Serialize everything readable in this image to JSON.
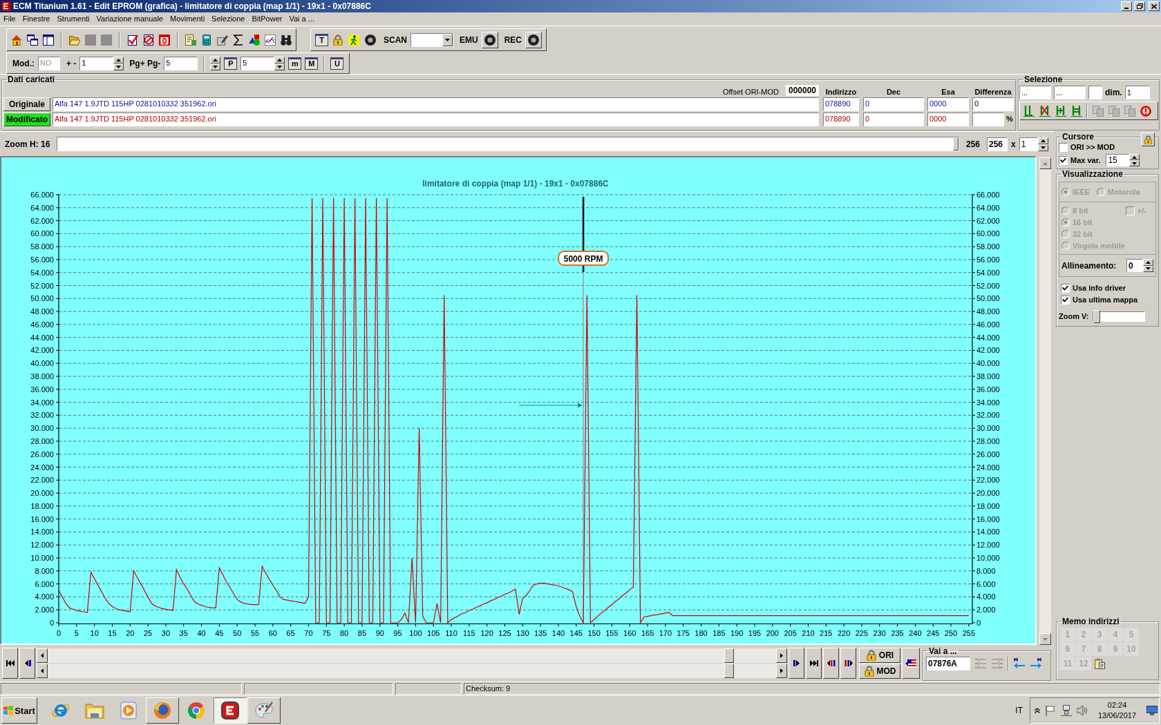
{
  "window": {
    "title": "ECM Titanium 1.61 - Edit EPROM (grafica) - limitatore di coppia (map 1/1) - 19x1 - 0x07886C"
  },
  "menu": [
    "File",
    "Finestre",
    "Strumenti",
    "Variazione manuale",
    "Movimenti",
    "Selezione",
    "BitPower",
    "Vai a ..."
  ],
  "toolbar": {
    "t_button": "T",
    "scan_label": "SCAN",
    "emu_label": "EMU",
    "rec_label": "REC"
  },
  "edit_bar": {
    "mod_label": "Mod.:",
    "mod_field": {
      "value": "NO",
      "disabled": true
    },
    "step_label": "+ -",
    "step_value": "1",
    "page_label": "Pg+ Pg-",
    "page_value": "5",
    "p_button": "P",
    "p_value": "5",
    "m_button": "m",
    "big_m_button": "M",
    "u_button": "U"
  },
  "loaded_data": {
    "title": "Dati caricati",
    "offset_label": "Offset ORI-MOD",
    "offset_value": "000000",
    "columns": [
      "Indirizzo",
      "Dec",
      "Esa",
      "Differenza"
    ],
    "rows": [
      {
        "label": "Originale",
        "selected": false,
        "color": "#10109a",
        "file": "Alfa 147 1.9JTD 115HP 0281010332 351962.ori",
        "address": "078890",
        "dec": "0",
        "hex": "0000",
        "difference": "0"
      },
      {
        "label": "Modificato",
        "selected": true,
        "color": "#b00000",
        "file": "Alfa 147 1.9JTD 115HP 0281010332 351962.ori",
        "address": "078890",
        "dec": "0",
        "hex": "0000",
        "unit": "%"
      }
    ]
  },
  "selection": {
    "title": "Selezione",
    "start": "...",
    "end": "...",
    "dim_label": "dim.",
    "dim_value": "1",
    "tools": [
      {
        "disabled": false
      },
      {
        "disabled": false
      },
      {
        "disabled": false
      },
      {
        "disabled": false
      },
      {
        "disabled": true
      },
      {
        "disabled": true
      },
      {
        "disabled": true
      },
      {
        "disabled": false
      }
    ]
  },
  "zoom_h": {
    "label": "Zoom H: 16",
    "level": 1,
    "max_label": "256",
    "value": "256",
    "times_label": "x",
    "factor": "1"
  },
  "chart": {
    "chart_data": {
      "type": "line",
      "title": "limitatore di coppia (map 1/1) - 19x1 - 0x07886C",
      "x": [
        0,
        1,
        2,
        3,
        4,
        5,
        6,
        7,
        8,
        9,
        10,
        11,
        12,
        13,
        14,
        15,
        16,
        17,
        18,
        19,
        20,
        21,
        22,
        23,
        24,
        25,
        26,
        27,
        28,
        29,
        30,
        31,
        32,
        33,
        34,
        35,
        36,
        37,
        38,
        39,
        40,
        41,
        42,
        43,
        44,
        45,
        46,
        47,
        48,
        49,
        50,
        51,
        52,
        53,
        54,
        55,
        56,
        57,
        58,
        59,
        60,
        61,
        62,
        63,
        64,
        65,
        66,
        67,
        68,
        69,
        70,
        71,
        72,
        73,
        74,
        75,
        76,
        77,
        78,
        79,
        80,
        81,
        82,
        83,
        84,
        85,
        86,
        87,
        88,
        89,
        90,
        91,
        92,
        93,
        94,
        95,
        96,
        97,
        98,
        99,
        100,
        101,
        102,
        103,
        104,
        105,
        106,
        107,
        108,
        109,
        110,
        111,
        112,
        113,
        114,
        115,
        116,
        117,
        118,
        119,
        120,
        121,
        122,
        123,
        124,
        125,
        126,
        127,
        128,
        129,
        130,
        131,
        132,
        133,
        134,
        135,
        136,
        137,
        138,
        139,
        140,
        141,
        142,
        143,
        144,
        145,
        146,
        147,
        148,
        149,
        150,
        151,
        152,
        153,
        154,
        155,
        156,
        157,
        158,
        159,
        160,
        161,
        162,
        163,
        164,
        165,
        166,
        167,
        168,
        169,
        170,
        171,
        172,
        173,
        174,
        175,
        176,
        177,
        178,
        179,
        180,
        181,
        182,
        183,
        184,
        185,
        186,
        187,
        188,
        189,
        190,
        191,
        192,
        193,
        194,
        195,
        196,
        197,
        198,
        199,
        200,
        201,
        202,
        203,
        204,
        205,
        206,
        207,
        208,
        209,
        210,
        211,
        212,
        213,
        214,
        215,
        216,
        217,
        218,
        219,
        220,
        221,
        222,
        223,
        224,
        225,
        226,
        227,
        228,
        229,
        230,
        231,
        232,
        233,
        234,
        235,
        236,
        237,
        238,
        239,
        240,
        241,
        242,
        243,
        244,
        245,
        246,
        247,
        248,
        249,
        250,
        251,
        252,
        253,
        254,
        255
      ],
      "xlim": [
        0,
        256
      ],
      "ylim": [
        0,
        66
      ],
      "xticks": [
        0,
        5,
        10,
        15,
        20,
        25,
        30,
        35,
        40,
        45,
        50,
        55,
        60,
        65,
        70,
        75,
        80,
        85,
        90,
        95,
        100,
        105,
        110,
        115,
        120,
        125,
        130,
        135,
        140,
        145,
        150,
        155,
        160,
        165,
        170,
        175,
        180,
        185,
        190,
        195,
        200,
        205,
        210,
        215,
        220,
        225,
        230,
        235,
        240,
        245,
        250,
        255
      ],
      "yticks": [
        {
          "value": 0,
          "label": "0"
        },
        {
          "value": 2,
          "label": "2.000"
        },
        {
          "value": 4,
          "label": "4.000"
        },
        {
          "value": 6,
          "label": "6.000"
        },
        {
          "value": 8,
          "label": "8.000"
        },
        {
          "value": 10,
          "label": "10.000"
        },
        {
          "value": 12,
          "label": "12.000"
        },
        {
          "value": 14,
          "label": "14.000"
        },
        {
          "value": 16,
          "label": "16.000"
        },
        {
          "value": 18,
          "label": "18.000"
        },
        {
          "value": 20,
          "label": "20.000"
        },
        {
          "value": 22,
          "label": "22.000"
        },
        {
          "value": 24,
          "label": "24.000"
        },
        {
          "value": 26,
          "label": "26.000"
        },
        {
          "value": 28,
          "label": "28.000"
        },
        {
          "value": 30,
          "label": "30.000"
        },
        {
          "value": 32,
          "label": "32.000"
        },
        {
          "value": 34,
          "label": "34.000"
        },
        {
          "value": 36,
          "label": "36.000"
        },
        {
          "value": 38,
          "label": "38.000"
        },
        {
          "value": 40,
          "label": "40.000"
        },
        {
          "value": 42,
          "label": "42.000"
        },
        {
          "value": 44,
          "label": "44.000"
        },
        {
          "value": 46,
          "label": "46.000"
        },
        {
          "value": 48,
          "label": "48.000"
        },
        {
          "value": 50,
          "label": "50.000"
        },
        {
          "value": 52,
          "label": "52.000"
        },
        {
          "value": 54,
          "label": "54.000"
        },
        {
          "value": 56,
          "label": "56.000"
        },
        {
          "value": 58,
          "label": "58.000"
        },
        {
          "value": 60,
          "label": "60.000"
        },
        {
          "value": 62,
          "label": "62.000"
        },
        {
          "value": 64,
          "label": "64.000"
        },
        {
          "value": 66,
          "label": "66.000"
        }
      ],
      "grid": true,
      "series": [
        {
          "color": "#d00000",
          "values": [
            5,
            4,
            3,
            2.3,
            2.1,
            1.9,
            1.8,
            1.7,
            1.6,
            7.8,
            6.8,
            5.8,
            4.8,
            3.8,
            3,
            2.5,
            2.2,
            2,
            1.9,
            1.8,
            1.7,
            8,
            7,
            6,
            5,
            4,
            3,
            2.6,
            2.4,
            2.2,
            2.1,
            2,
            1.9,
            8.2,
            7,
            6,
            5.2,
            4.2,
            3.3,
            2.9,
            2.7,
            2.5,
            2.4,
            2.3,
            2.3,
            8.5,
            7.4,
            6.3,
            5.4,
            4.5,
            3.6,
            3.2,
            3,
            2.9,
            2.8,
            2.8,
            2.8,
            8.7,
            7.7,
            6.7,
            5.8,
            5,
            4,
            3.6,
            3.5,
            3.4,
            3.3,
            3.2,
            3.1,
            3,
            4,
            65.5,
            0,
            0,
            65.5,
            0,
            0,
            65.5,
            0,
            0,
            65.5,
            0,
            0,
            65.5,
            0,
            0,
            65.5,
            0,
            0,
            65.5,
            0,
            0,
            65.5,
            0,
            0,
            0,
            0.5,
            1.5,
            0,
            10,
            0,
            30,
            1,
            0,
            0,
            0,
            3,
            0,
            50.5,
            0,
            0.5,
            0.8,
            1.1,
            1.4,
            1.6,
            1.9,
            2.1,
            2.4,
            2.6,
            2.9,
            3.1,
            3.4,
            3.6,
            3.9,
            4.1,
            4.4,
            4.6,
            4.9,
            5.2,
            1.3,
            3.8,
            4.2,
            5,
            5.8,
            6,
            6.1,
            6.1,
            6,
            5.9,
            5.8,
            5.7,
            5.5,
            5.3,
            5.1,
            4.8,
            2.5,
            1,
            0,
            50.5,
            0,
            0.5,
            1,
            1.5,
            1.9,
            2.4,
            2.8,
            3.3,
            3.7,
            4.2,
            4.6,
            5.1,
            5.5,
            50.5,
            0,
            0.9,
            1,
            1.1,
            1.2,
            1.3,
            1.4,
            1.5,
            1.6,
            1.1,
            1.1,
            1.1,
            1.1,
            1.1,
            1.1,
            1.1,
            1.1,
            1.1,
            1.1,
            1.1,
            1.1,
            1.1,
            1.1,
            1.1,
            1.1,
            1.1,
            1.1,
            1.1,
            1.1,
            1.1,
            1.1,
            1.1,
            1.1,
            1.1,
            1.1,
            1.1,
            1.1,
            1.1,
            1.1,
            1.1,
            1.1,
            1.1,
            1.1,
            1.1,
            1.1,
            1.1,
            1.1,
            1.1,
            1.1,
            1.1,
            1.1,
            1.1,
            1.1,
            1.1,
            1.1,
            1.1,
            1.1,
            1.1,
            1.1,
            1.1,
            1.1,
            1.1,
            1.1,
            1.1,
            1.1,
            1.1,
            1.1,
            1.1,
            1.1,
            1.1,
            1.1,
            1.1,
            1.1,
            1.1,
            1.1,
            1.1,
            1.1,
            1.1,
            1.1,
            1.1,
            1.1,
            1.1,
            1.1,
            1.1,
            1.1,
            1.1,
            1.1,
            1.1,
            1.1,
            1.1,
            1.1,
            1.1,
            1.1
          ]
        }
      ],
      "ref_lines": [
        {
          "axis": "x",
          "value": 147,
          "color": "#a0a0a0"
        },
        {
          "axis": "x",
          "value": 147,
          "label": "5000 RPM",
          "color": "#000000"
        }
      ]
    }
  },
  "cursor_panel": {
    "title": "Cursore",
    "options": [
      {
        "label": "ORI >> MOD",
        "checked": false
      },
      {
        "label": "Max var.",
        "checked": true,
        "value": "15"
      }
    ]
  },
  "display_panel": {
    "title": "Visualizzazione",
    "byte_order": [
      {
        "label": "IEEE",
        "selected": true,
        "disabled": true
      },
      {
        "label": "Motorola",
        "selected": false,
        "disabled": true
      }
    ],
    "formats": [
      {
        "label": "8 bit",
        "selected": false,
        "disabled": true
      },
      {
        "label": "16 bit",
        "selected": true,
        "disabled": true
      },
      {
        "label": "32 bit",
        "selected": false,
        "disabled": true
      },
      {
        "label": "Virgola mobile",
        "selected": false,
        "disabled": true
      }
    ],
    "signed": {
      "label": "+/-",
      "checked": false,
      "disabled": true
    },
    "alignment_label": "Allineamento:",
    "alignment_value": "0",
    "options": [
      {
        "label": "Usa info driver",
        "checked": true
      },
      {
        "label": "Usa ultima mappa",
        "checked": true
      }
    ],
    "zoom_v": {
      "label": "Zoom V:",
      "level": 0
    }
  },
  "memo": {
    "title": "Memo indirizzi",
    "slots": [
      {
        "label": "1",
        "disabled": true
      },
      {
        "label": "2",
        "disabled": true
      },
      {
        "label": "3",
        "disabled": true
      },
      {
        "label": "4",
        "disabled": true
      },
      {
        "label": "5",
        "disabled": true
      },
      {
        "label": "6",
        "disabled": true
      },
      {
        "label": "7",
        "disabled": true
      },
      {
        "label": "8",
        "disabled": true
      },
      {
        "label": "9",
        "disabled": true
      },
      {
        "label": "10",
        "disabled": true
      },
      {
        "label": "11",
        "disabled": true
      },
      {
        "label": "12",
        "disabled": true
      }
    ]
  },
  "navigation": {
    "ori_button": "ORI",
    "mod_button": "MOD",
    "goto": {
      "title": "Vai a ...",
      "value": "07876A",
      "tools": [
        {
          "disabled": true
        },
        {
          "disabled": true
        },
        {
          "disabled": false
        },
        {
          "disabled": false
        }
      ]
    }
  },
  "status_bar": {
    "checksum": "Checksum: 9"
  },
  "taskbar": {
    "start": "Start",
    "apps": [
      {
        "open": false,
        "selected": false
      },
      {
        "open": false,
        "selected": false
      },
      {
        "open": false,
        "selected": false
      },
      {
        "open": true,
        "selected": false
      },
      {
        "open": false,
        "selected": false
      },
      {
        "open": true,
        "selected": true
      },
      {
        "open": true,
        "selected": false
      }
    ],
    "language": "IT",
    "time": "02:24",
    "date": "13/06/2017"
  }
}
